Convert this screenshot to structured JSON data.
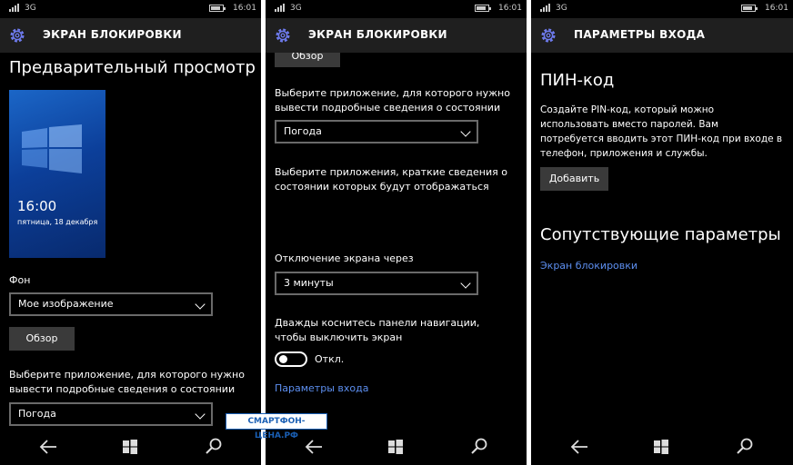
{
  "status": {
    "network": "3G",
    "time": "16:01"
  },
  "panel1": {
    "title": "ЭКРАН БЛОКИРОВКИ",
    "preview_heading": "Предварительный просмотр",
    "preview_time": "16:00",
    "preview_date": "пятница, 18 декабря",
    "background_label": "Фон",
    "background_value": "Мое изображение",
    "browse_label": "Обзор",
    "detail_app_label": "Выберите приложение, для которого нужно вывести подробные сведения о состоянии",
    "detail_app_value": "Погода"
  },
  "panel2": {
    "title": "ЭКРАН БЛОКИРОВКИ",
    "browse_label": "Обзор",
    "detail_app_label": "Выберите приложение, для которого нужно вывести подробные сведения о состоянии",
    "detail_app_value": "Погода",
    "quick_apps_label": "Выберите приложения, краткие сведения о состоянии которых будут отображаться",
    "quick_apps": [
      {
        "icon": "phone-icon"
      },
      {
        "icon": "message-icon"
      },
      {
        "icon": "outlook-icon"
      },
      {
        "icon": "plus-icon",
        "glyph": "+"
      },
      {
        "icon": "plus-icon",
        "glyph": "+"
      }
    ],
    "screen_timeout_label": "Отключение экрана через",
    "screen_timeout_value": "3 минуты",
    "double_tap_label": "Дважды коснитесь панели навигации, чтобы выключить экран",
    "toggle_state": "Откл.",
    "signin_link": "Параметры входа"
  },
  "panel3": {
    "title": "ПАРАМЕТРЫ ВХОДА",
    "pin_heading": "ПИН-код",
    "pin_description": "Создайте PIN-код, который можно использовать вместо паролей. Вам потребуется вводить этот ПИН-код при входе в телефон, приложения и службы.",
    "add_button": "Добавить",
    "related_heading": "Сопутствующие параметры",
    "lockscreen_link": "Экран блокировки"
  },
  "watermark": "СМАРТФОН-ЦЕНА.РФ",
  "colors": {
    "accent": "#5d8ff0",
    "header": "#1f1f1f",
    "button": "#3a3a3a"
  }
}
